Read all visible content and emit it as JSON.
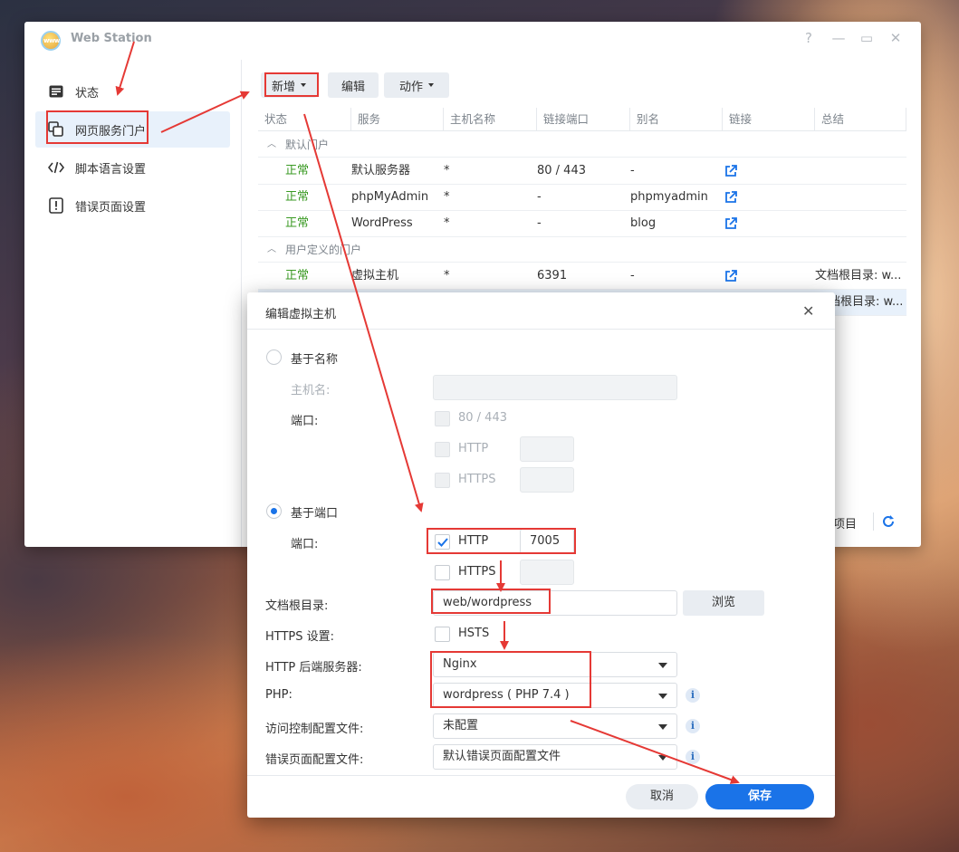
{
  "window": {
    "title": "Web Station",
    "help": "?",
    "minimize": "—",
    "maximize": "▭",
    "close": "✕"
  },
  "sidebar": {
    "items": [
      {
        "label": "状态",
        "icon": "status-icon"
      },
      {
        "label": "网页服务门户",
        "icon": "portal-icon",
        "active": true
      },
      {
        "label": "脚本语言设置",
        "icon": "code-icon"
      },
      {
        "label": "错误页面设置",
        "icon": "error-page-icon"
      }
    ]
  },
  "toolbar": {
    "add_label": "新增",
    "edit_label": "编辑",
    "action_label": "动作"
  },
  "table": {
    "columns": [
      "状态",
      "服务",
      "主机名称",
      "链接端口",
      "别名",
      "链接",
      "总结"
    ],
    "group_default": "默认门户",
    "group_custom": "用户定义的门户",
    "default_rows": [
      {
        "status": "正常",
        "service": "默认服务器",
        "host": "*",
        "port": "80 / 443",
        "alias": "-"
      },
      {
        "status": "正常",
        "service": "phpMyAdmin",
        "host": "*",
        "port": "-",
        "alias": "phpmyadmin"
      },
      {
        "status": "正常",
        "service": "WordPress",
        "host": "*",
        "port": "-",
        "alias": "blog"
      }
    ],
    "custom_rows": [
      {
        "status": "正常",
        "service": "虚拟主机",
        "host": "*",
        "port": "6391",
        "alias": "-",
        "summary": "文档根目录: w..."
      },
      {
        "summary": "档根目录: w..."
      }
    ],
    "footer_items": "项目"
  },
  "dialog": {
    "title": "编辑虚拟主机",
    "close": "✕",
    "by_name_label": "基于名称",
    "hostname_label": "主机名:",
    "hostname_value": "",
    "port_label_name": "端口:",
    "port_80_443": "80 / 443",
    "http_label_1": "HTTP",
    "https_label_1": "HTTPS",
    "by_port_label": "基于端口",
    "port_label_port": "端口:",
    "http_label_2": "HTTP",
    "http_port_value": "7005",
    "https_label_2": "HTTPS",
    "docroot_label": "文档根目录:",
    "docroot_value": "web/wordpress",
    "browse_label": "浏览",
    "https_settings_label": "HTTPS 设置:",
    "hsts_label": "HSTS",
    "backend_label": "HTTP 后端服务器:",
    "backend_value": "Nginx",
    "php_label": "PHP:",
    "php_value": "wordpress ( PHP 7.4 )",
    "access_label": "访问控制配置文件:",
    "access_value": "未配置",
    "errorpage_label": "错误页面配置文件:",
    "errorpage_value": "默认错误页面配置文件",
    "info_glyph": "i",
    "cancel_label": "取消",
    "save_label": "保存"
  },
  "colors": {
    "accent": "#1a73e8",
    "status_ok": "#3a9a23",
    "annotation": "#e53935"
  }
}
